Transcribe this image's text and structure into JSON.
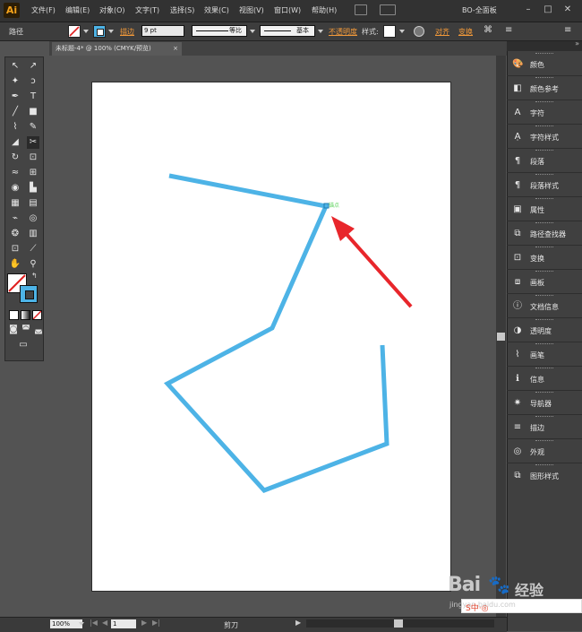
{
  "app": {
    "logo": "Ai",
    "workspace": "BO-全面板"
  },
  "menu": [
    "文件(F)",
    "编辑(E)",
    "对象(O)",
    "文字(T)",
    "选择(S)",
    "效果(C)",
    "视图(V)",
    "窗口(W)",
    "帮助(H)"
  ],
  "control_bar": {
    "selection_label": "路径",
    "stroke_label": "描边",
    "stroke_weight": "9 pt",
    "profile_label": "等比",
    "brush_label": "基本",
    "opacity_label": "不透明度",
    "style_label": "样式:",
    "align_label": "对齐",
    "transform_label": "变换"
  },
  "document": {
    "tab_title": "未标题-4* @ 100% (CMYK/预览)"
  },
  "canvas": {
    "anchor_hint": "锚点",
    "stroke_color": "#4db3e6",
    "arrow_color": "#e8262b"
  },
  "status": {
    "zoom": "100%",
    "page": "1",
    "tool": "剪刀"
  },
  "panels": [
    {
      "label": "颜色",
      "icon": "color-icon"
    },
    {
      "label": "颜色参考",
      "icon": "color-guide-icon"
    },
    {
      "label": "字符",
      "icon": "character-icon"
    },
    {
      "label": "字符样式",
      "icon": "character-styles-icon"
    },
    {
      "label": "段落",
      "icon": "paragraph-icon"
    },
    {
      "label": "段落样式",
      "icon": "paragraph-styles-icon"
    },
    {
      "label": "属性",
      "icon": "attributes-icon"
    },
    {
      "label": "路径查找器",
      "icon": "pathfinder-icon"
    },
    {
      "label": "变换",
      "icon": "transform-icon"
    },
    {
      "label": "画板",
      "icon": "artboards-icon"
    },
    {
      "label": "文档信息",
      "icon": "document-info-icon"
    },
    {
      "label": "透明度",
      "icon": "transparency-icon"
    },
    {
      "label": "画笔",
      "icon": "brushes-icon"
    },
    {
      "label": "信息",
      "icon": "info-icon"
    },
    {
      "label": "导航器",
      "icon": "navigator-icon"
    },
    {
      "label": "描边",
      "icon": "stroke-icon"
    },
    {
      "label": "外观",
      "icon": "appearance-icon"
    },
    {
      "label": "图形样式",
      "icon": "graphic-styles-icon"
    }
  ],
  "watermark": {
    "logo": "Bai",
    "sub": "经验",
    "url": "jingyan.baidu.com",
    "bar_text": "S中·◎"
  }
}
